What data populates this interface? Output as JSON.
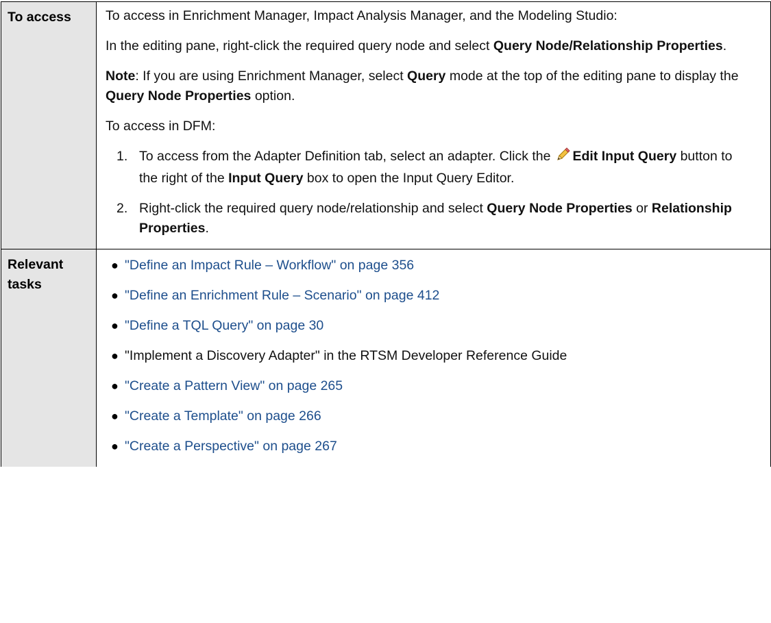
{
  "access": {
    "header": "To access",
    "p1": "To access in Enrichment Manager, Impact Analysis Manager, and the Modeling Studio:",
    "p2": {
      "pre": "In the editing pane, right-click the required query node and select ",
      "bold": "Query Node/Relationship Properties",
      "post": "."
    },
    "note": {
      "label": "Note",
      "t1": ": If you are using Enrichment Manager, select ",
      "b1": "Query",
      "t2": " mode at the top of the editing pane to display the ",
      "b2": "Query Node Properties",
      "t3": " option."
    },
    "p3": "To access in DFM:",
    "step1": {
      "num": "1.",
      "t1": "To access from the Adapter Definition tab, select an adapter. Click the",
      "b1": "Edit Input Query",
      "t2": " button to the right of the ",
      "b2": "Input Query",
      "t3": " box to open the Input Query Editor.",
      "icon": "pencil-icon"
    },
    "step2": {
      "num": "2.",
      "t1": "Right-click the required query node/relationship and select ",
      "b1": "Query Node Properties",
      "t2": " or ",
      "b2": "Relationship Properties",
      "t3": "."
    }
  },
  "tasks": {
    "header": "Relevant tasks",
    "items": [
      "\"Define an Impact Rule – Workflow\" on page 356",
      "\"Define an Enrichment Rule – Scenario\" on page 412",
      "\"Define a TQL Query\" on page 30",
      "\"Implement a Discovery Adapter\" in the RTSM Developer Reference Guide",
      "\"Create a Pattern View\" on page 265",
      "\"Create a Template\" on page 266",
      "\"Create a Perspective\" on page 267"
    ]
  },
  "colors": {
    "link": "#1d4e8c",
    "header_bg": "#e5e5e5",
    "border": "#000000"
  }
}
